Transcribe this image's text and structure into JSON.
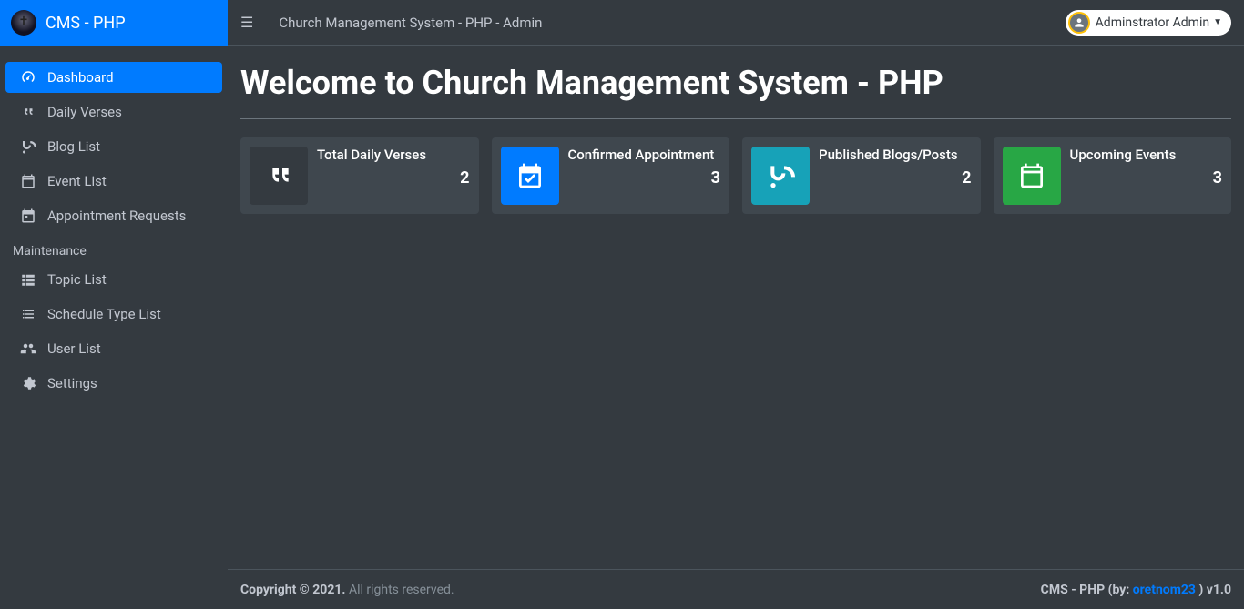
{
  "brand": {
    "text": "CMS - PHP"
  },
  "header": {
    "title": "Church Management System - PHP - Admin",
    "user_name": "Adminstrator Admin"
  },
  "sidebar": {
    "main": [
      {
        "label": "Dashboard"
      },
      {
        "label": "Daily Verses"
      },
      {
        "label": "Blog List"
      },
      {
        "label": "Event List"
      },
      {
        "label": "Appointment Requests"
      }
    ],
    "maintenance_header": "Maintenance",
    "maintenance": [
      {
        "label": "Topic List"
      },
      {
        "label": "Schedule Type List"
      },
      {
        "label": "User List"
      },
      {
        "label": "Settings"
      }
    ]
  },
  "page": {
    "title": "Welcome to Church Management System - PHP"
  },
  "cards": {
    "verses": {
      "title": "Total Daily Verses",
      "value": "2"
    },
    "appts": {
      "title": "Confirmed Appointment",
      "value": "3"
    },
    "blogs": {
      "title": "Published Blogs/Posts",
      "value": "2"
    },
    "events": {
      "title": "Upcoming Events",
      "value": "3"
    }
  },
  "footer": {
    "copyright_bold": "Copyright © 2021.",
    "copyright_rest": " All rights reserved.",
    "right_prefix": "CMS - PHP (by: ",
    "right_link": "oretnom23",
    "right_suffix": " ) v1.0"
  }
}
